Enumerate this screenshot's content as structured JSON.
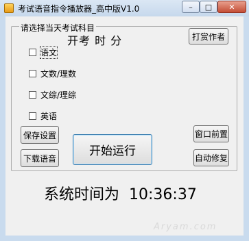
{
  "window": {
    "title": "考试语音指令播放器_高中版V1.0",
    "controls": {
      "minimize": "–",
      "maximize": "□",
      "close": "✕"
    }
  },
  "subject_group": {
    "legend": "请选择当天考试科目",
    "exam_time_label": "开考 时 分",
    "subjects": [
      {
        "label": "语文",
        "checked": false
      },
      {
        "label": "文数/理数",
        "checked": false
      },
      {
        "label": "文综/理综",
        "checked": false
      },
      {
        "label": "英语",
        "checked": false
      }
    ]
  },
  "buttons": {
    "donate": "打赏作者",
    "save_settings": "保存设置",
    "download_audio": "下载语音",
    "start": "开始运行",
    "window_front": "窗口前置",
    "auto_repair": "自动修复"
  },
  "system_time": {
    "label": "系统时间为",
    "value": "10:36:37"
  },
  "watermark": "Aryam.com",
  "colors": {
    "title_bar": "#c9dbee",
    "client_bg": "#f0f0f0",
    "close_button": "#c44d35",
    "start_button_border": "#3c7fb1"
  }
}
